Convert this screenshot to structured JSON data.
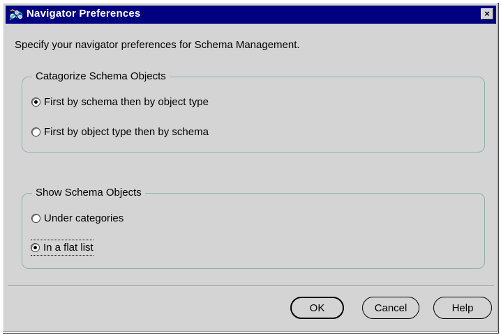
{
  "window": {
    "title": "Navigator Preferences",
    "title_icon": "navigator-icon",
    "close_label": "×"
  },
  "intro_text": "Specify your navigator preferences for Schema Management.",
  "categorize_group": {
    "legend": "Catagorize Schema Objects",
    "options": [
      {
        "label": "First by schema then by object type",
        "selected": true
      },
      {
        "label": "First by object type then by schema",
        "selected": false
      }
    ]
  },
  "show_group": {
    "legend": "Show Schema Objects",
    "options": [
      {
        "label": "Under categories",
        "selected": false
      },
      {
        "label": "In a flat list",
        "selected": true
      }
    ]
  },
  "buttons": {
    "ok": "OK",
    "cancel": "Cancel",
    "help": "Help"
  },
  "colors": {
    "titlebar": "#000080",
    "dialog_bg": "#d4d4d4",
    "group_border": "#8fb2b2"
  }
}
